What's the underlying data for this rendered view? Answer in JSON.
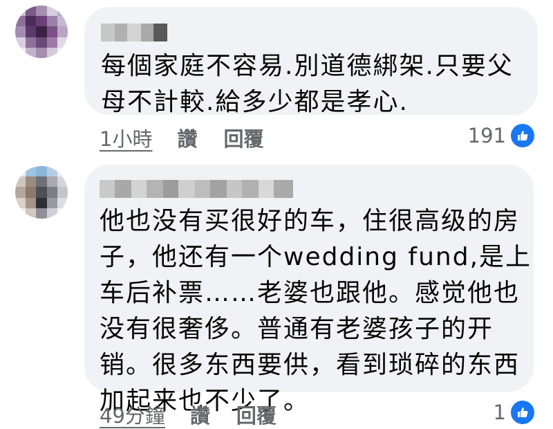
{
  "comments": [
    {
      "text_lines": [
        "每個家庭不容易.別道德綁架.只要父",
        "母不計較.給多少都是孝心."
      ],
      "time": "1小時",
      "like_label": "讚",
      "reply_label": "回覆",
      "like_count": "191"
    },
    {
      "text_lines": [
        "他也没有买很好的车，住很高级的房",
        "子，他还有一个wedding fund,是上",
        "车后补票……老婆也跟他。感觉他也",
        "没有很奢侈。普通有老婆孩子的开",
        "销。很多东西要供，看到琐碎的东西",
        "加起来也不少了。"
      ],
      "time": "49分鐘",
      "like_label": "讚",
      "reply_label": "回覆",
      "like_count": "1"
    }
  ],
  "colors": {
    "bubble": "#f0f2f5",
    "meta_text": "#65676b",
    "like_badge": "#1877f2"
  },
  "icons": {
    "like": "thumbs-up-icon"
  }
}
